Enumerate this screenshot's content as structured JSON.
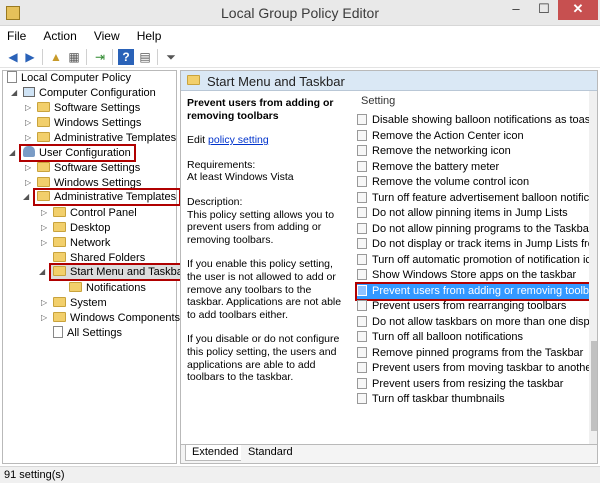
{
  "window": {
    "title": "Local Group Policy Editor",
    "minimize": "–",
    "maximize": "☐",
    "close": "✕"
  },
  "menu": [
    "File",
    "Action",
    "View",
    "Help"
  ],
  "toolbar": {
    "back": "◀",
    "forward": "▶",
    "up": "▲",
    "show_tree": "▦",
    "export": "⇥",
    "help": "?",
    "properties": "▤",
    "filter": "⏷"
  },
  "tree": {
    "root": "Local Computer Policy",
    "computer_configuration": "Computer Configuration",
    "cc_software_settings": "Software Settings",
    "cc_windows_settings": "Windows Settings",
    "cc_admin_templates": "Administrative Templates",
    "user_configuration": "User Configuration",
    "uc_software_settings": "Software Settings",
    "uc_windows_settings": "Windows Settings",
    "uc_admin_templates": "Administrative Templates",
    "control_panel": "Control Panel",
    "desktop": "Desktop",
    "network": "Network",
    "shared_folders": "Shared Folders",
    "start_menu_taskbar": "Start Menu and Taskbar",
    "notifications": "Notifications",
    "system": "System",
    "windows_components": "Windows Components",
    "all_settings": "All Settings"
  },
  "right": {
    "header": "Start Menu and Taskbar",
    "column_header": "Setting",
    "policy_name": "Prevent users from adding or removing toolbars",
    "edit_prefix": "Edit",
    "edit_link": "policy setting",
    "requirements_label": "Requirements:",
    "requirements_value": "At least Windows Vista",
    "description_label": "Description:",
    "description_1": "This policy setting allows you to prevent users from adding or removing toolbars.",
    "description_2": "If you enable this policy setting, the user is not allowed to add or remove any toolbars to the taskbar. Applications are not able to add toolbars either.",
    "description_3": "If you disable or do not configure this policy setting, the users and applications are able to add toolbars to the taskbar."
  },
  "settings": [
    "Disable showing balloon notifications as toasts.",
    "Remove the Action Center icon",
    "Remove the networking icon",
    "Remove the battery meter",
    "Remove the volume control icon",
    "Turn off feature advertisement balloon notifications",
    "Do not allow pinning items in Jump Lists",
    "Do not allow pinning programs to the Taskbar",
    "Do not display or track items in Jump Lists from remote locations",
    "Turn off automatic promotion of notification icons to the taskbar",
    "Show Windows Store apps on the taskbar",
    "Prevent users from adding or removing toolbars",
    "Prevent users from rearranging toolbars",
    "Do not allow taskbars on more than one display",
    "Turn off all balloon notifications",
    "Remove pinned programs from the Taskbar",
    "Prevent users from moving taskbar to another screen dock location",
    "Prevent users from resizing the taskbar",
    "Turn off taskbar thumbnails"
  ],
  "tabs": [
    "Extended",
    "Standard"
  ],
  "status": "91 setting(s)"
}
